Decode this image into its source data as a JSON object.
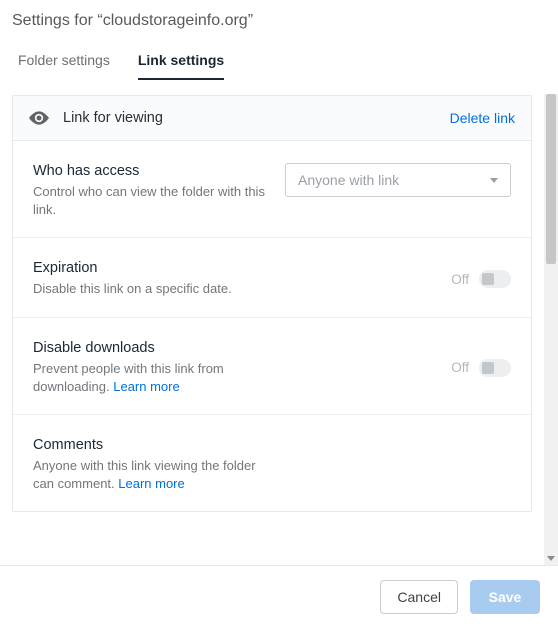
{
  "header": {
    "title": "Settings for “cloudstorageinfo.org”"
  },
  "tabs": {
    "folder": "Folder settings",
    "link": "Link settings"
  },
  "panel": {
    "head_title": "Link for viewing",
    "delete": "Delete link"
  },
  "access": {
    "title": "Who has access",
    "desc": "Control who can view the folder with this link.",
    "selected": "Anyone with link"
  },
  "expiration": {
    "title": "Expiration",
    "desc": "Disable this link on a specific date.",
    "state": "Off"
  },
  "downloads": {
    "title": "Disable downloads",
    "desc": "Prevent people with this link from downloading. ",
    "learn": "Learn more",
    "state": "Off"
  },
  "comments": {
    "title": "Comments",
    "desc": "Anyone with this link viewing the folder can comment. ",
    "learn": "Learn more"
  },
  "footer": {
    "cancel": "Cancel",
    "save": "Save"
  }
}
